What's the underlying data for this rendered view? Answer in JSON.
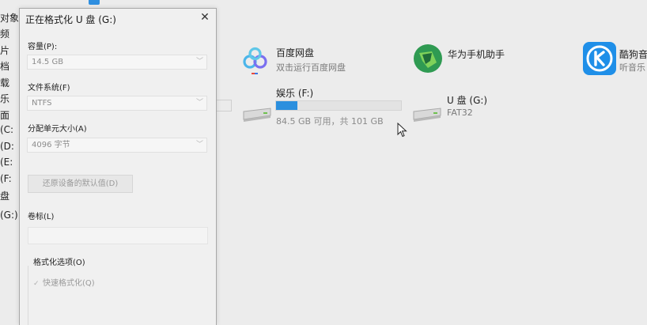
{
  "nav_pane": {
    "items": [
      "对象",
      "频",
      "片",
      "档",
      "载",
      "乐",
      "面",
      "(C:",
      "(D:",
      "(E:",
      "(F:",
      "盘",
      "(G:)"
    ]
  },
  "dialog": {
    "title": "正在格式化 U 盘 (G:)",
    "capacity_label": "容量(P):",
    "capacity_value": "14.5 GB",
    "filesystem_label": "文件系统(F)",
    "filesystem_value": "NTFS",
    "alloc_label": "分配单元大小(A)",
    "alloc_value": "4096 字节",
    "restore_button": "还原设备的默认值(D)",
    "volume_label": "卷标(L)",
    "volume_value": "",
    "options_label": "格式化选项(O)",
    "quick_format_label": "快速格式化(Q)",
    "quick_format_checked": true
  },
  "apps": [
    {
      "name": "百度网盘",
      "sub": "双击运行百度网盘",
      "icon": "baidu-netdisk-icon"
    },
    {
      "name": "华为手机助手",
      "sub": "",
      "icon": "huawei-hisuite-icon"
    },
    {
      "name": "酷狗音",
      "sub": "听音乐",
      "icon": "kugou-icon"
    }
  ],
  "drives": [
    {
      "name": "娱乐 (F:)",
      "info": "84.5 GB 可用，共 101 GB",
      "used_fraction": 0.17
    },
    {
      "name": "U 盘 (G:)",
      "info": "FAT32"
    }
  ],
  "colors": {
    "accent": "#2b8fde",
    "huawei_green": "#2f9a52",
    "kugou_blue": "#1f8fe8"
  }
}
